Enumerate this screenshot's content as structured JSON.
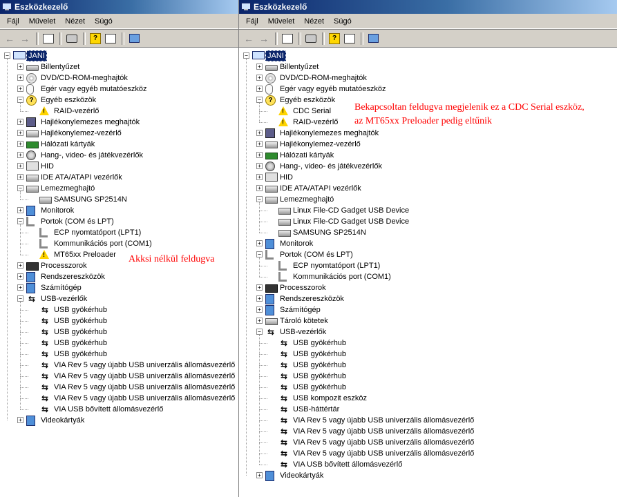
{
  "left": {
    "title": "Eszközkezelő",
    "menu": [
      "Fájl",
      "Művelet",
      "Nézet",
      "Súgó"
    ],
    "annotation": "Akksi nélkül feldugva",
    "tree": [
      {
        "level": 0,
        "text": "JANI",
        "icon": "computer-icon",
        "exp": "-",
        "selected": true
      },
      {
        "level": 1,
        "text": "Billentyűzet",
        "icon": "keyboard-icon",
        "exp": "+"
      },
      {
        "level": 1,
        "text": "DVD/CD-ROM-meghajtók",
        "icon": "disc-icon",
        "exp": "+"
      },
      {
        "level": 1,
        "text": "Egér vagy egyéb mutatóeszköz",
        "icon": "mouse-icon",
        "exp": "+"
      },
      {
        "level": 1,
        "text": "Egyéb eszközök",
        "icon": "question-icon",
        "exp": "-"
      },
      {
        "level": 2,
        "text": "RAID-vezérlő",
        "icon": "warning-icon"
      },
      {
        "level": 1,
        "text": "Hajlékonylemezes meghajtók",
        "icon": "floppy-icon",
        "exp": "+"
      },
      {
        "level": 1,
        "text": "Hajlékonylemez-vezérlő",
        "icon": "hdd-icon",
        "exp": "+"
      },
      {
        "level": 1,
        "text": "Hálózati kártyák",
        "icon": "network-icon",
        "exp": "+"
      },
      {
        "level": 1,
        "text": "Hang-, video- és játékvezérlők",
        "icon": "speaker-icon",
        "exp": "+"
      },
      {
        "level": 1,
        "text": "HID",
        "icon": "hid-icon",
        "exp": "+"
      },
      {
        "level": 1,
        "text": "IDE ATA/ATAPI vezérlők",
        "icon": "hdd-icon",
        "exp": "+"
      },
      {
        "level": 1,
        "text": "Lemezmeghajtó",
        "icon": "hdd-icon",
        "exp": "-"
      },
      {
        "level": 2,
        "text": "SAMSUNG SP2514N",
        "icon": "hdd-icon"
      },
      {
        "level": 1,
        "text": "Monitorok",
        "icon": "monitor-icon",
        "exp": "+"
      },
      {
        "level": 1,
        "text": "Portok (COM és LPT)",
        "icon": "port-icon",
        "exp": "-"
      },
      {
        "level": 2,
        "text": "ECP nyomtatóport (LPT1)",
        "icon": "port-icon"
      },
      {
        "level": 2,
        "text": "Kommunikációs port (COM1)",
        "icon": "port-icon"
      },
      {
        "level": 2,
        "text": "MT65xx Preloader",
        "icon": "warning-icon"
      },
      {
        "level": 1,
        "text": "Processzorok",
        "icon": "cpu-icon",
        "exp": "+"
      },
      {
        "level": 1,
        "text": "Rendszereszközök",
        "icon": "system-icon",
        "exp": "+"
      },
      {
        "level": 1,
        "text": "Számítógép",
        "icon": "system-icon",
        "exp": "+"
      },
      {
        "level": 1,
        "text": "USB-vezérlők",
        "icon": "usb-icon",
        "exp": "-"
      },
      {
        "level": 2,
        "text": "USB gyökérhub",
        "icon": "usb-icon"
      },
      {
        "level": 2,
        "text": "USB gyökérhub",
        "icon": "usb-icon"
      },
      {
        "level": 2,
        "text": "USB gyökérhub",
        "icon": "usb-icon"
      },
      {
        "level": 2,
        "text": "USB gyökérhub",
        "icon": "usb-icon"
      },
      {
        "level": 2,
        "text": "USB gyökérhub",
        "icon": "usb-icon"
      },
      {
        "level": 2,
        "text": "VIA Rev 5 vagy újabb USB univerzális állomásvezérlő",
        "icon": "usb-icon"
      },
      {
        "level": 2,
        "text": "VIA Rev 5 vagy újabb USB univerzális állomásvezérlő",
        "icon": "usb-icon"
      },
      {
        "level": 2,
        "text": "VIA Rev 5 vagy újabb USB univerzális állomásvezérlő",
        "icon": "usb-icon"
      },
      {
        "level": 2,
        "text": "VIA Rev 5 vagy újabb USB univerzális állomásvezérlő",
        "icon": "usb-icon"
      },
      {
        "level": 2,
        "text": "VIA USB bővített állomásvezérlő",
        "icon": "usb-icon"
      },
      {
        "level": 1,
        "text": "Videokártyák",
        "icon": "video-icon",
        "exp": "+"
      }
    ]
  },
  "right": {
    "title": "Eszközkezelő",
    "menu": [
      "Fájl",
      "Művelet",
      "Nézet",
      "Súgó"
    ],
    "annotation_line1": "Bekapcsoltan feldugva megjelenik ez a CDC Serial eszköz,",
    "annotation_line2": "az MT65xx Preloader pedig eltűnik",
    "tree": [
      {
        "level": 0,
        "text": "JANI",
        "icon": "computer-icon",
        "exp": "-",
        "selected": true
      },
      {
        "level": 1,
        "text": "Billentyűzet",
        "icon": "keyboard-icon",
        "exp": "+"
      },
      {
        "level": 1,
        "text": "DVD/CD-ROM-meghajtók",
        "icon": "disc-icon",
        "exp": "+"
      },
      {
        "level": 1,
        "text": "Egér vagy egyéb mutatóeszköz",
        "icon": "mouse-icon",
        "exp": "+"
      },
      {
        "level": 1,
        "text": "Egyéb eszközök",
        "icon": "question-icon",
        "exp": "-"
      },
      {
        "level": 2,
        "text": "CDC Serial",
        "icon": "warning-icon"
      },
      {
        "level": 2,
        "text": "RAID-vezérlő",
        "icon": "warning-icon"
      },
      {
        "level": 1,
        "text": "Hajlékonylemezes meghajtók",
        "icon": "floppy-icon",
        "exp": "+"
      },
      {
        "level": 1,
        "text": "Hajlékonylemez-vezérlő",
        "icon": "hdd-icon",
        "exp": "+"
      },
      {
        "level": 1,
        "text": "Hálózati kártyák",
        "icon": "network-icon",
        "exp": "+"
      },
      {
        "level": 1,
        "text": "Hang-, video- és játékvezérlők",
        "icon": "speaker-icon",
        "exp": "+"
      },
      {
        "level": 1,
        "text": "HID",
        "icon": "hid-icon",
        "exp": "+"
      },
      {
        "level": 1,
        "text": "IDE ATA/ATAPI vezérlők",
        "icon": "hdd-icon",
        "exp": "+"
      },
      {
        "level": 1,
        "text": "Lemezmeghajtó",
        "icon": "hdd-icon",
        "exp": "-"
      },
      {
        "level": 2,
        "text": "Linux File-CD Gadget USB Device",
        "icon": "hdd-icon"
      },
      {
        "level": 2,
        "text": "Linux File-CD Gadget USB Device",
        "icon": "hdd-icon"
      },
      {
        "level": 2,
        "text": "SAMSUNG SP2514N",
        "icon": "hdd-icon"
      },
      {
        "level": 1,
        "text": "Monitorok",
        "icon": "monitor-icon",
        "exp": "+"
      },
      {
        "level": 1,
        "text": "Portok (COM és LPT)",
        "icon": "port-icon",
        "exp": "-"
      },
      {
        "level": 2,
        "text": "ECP nyomtatóport (LPT1)",
        "icon": "port-icon"
      },
      {
        "level": 2,
        "text": "Kommunikációs port (COM1)",
        "icon": "port-icon"
      },
      {
        "level": 1,
        "text": "Processzorok",
        "icon": "cpu-icon",
        "exp": "+"
      },
      {
        "level": 1,
        "text": "Rendszereszközök",
        "icon": "system-icon",
        "exp": "+"
      },
      {
        "level": 1,
        "text": "Számítógép",
        "icon": "system-icon",
        "exp": "+"
      },
      {
        "level": 1,
        "text": "Tároló kötetek",
        "icon": "hdd-icon",
        "exp": "+"
      },
      {
        "level": 1,
        "text": "USB-vezérlők",
        "icon": "usb-icon",
        "exp": "-"
      },
      {
        "level": 2,
        "text": "USB gyökérhub",
        "icon": "usb-icon"
      },
      {
        "level": 2,
        "text": "USB gyökérhub",
        "icon": "usb-icon"
      },
      {
        "level": 2,
        "text": "USB gyökérhub",
        "icon": "usb-icon"
      },
      {
        "level": 2,
        "text": "USB gyökérhub",
        "icon": "usb-icon"
      },
      {
        "level": 2,
        "text": "USB gyökérhub",
        "icon": "usb-icon"
      },
      {
        "level": 2,
        "text": "USB kompozit eszköz",
        "icon": "usb-icon"
      },
      {
        "level": 2,
        "text": "USB-háttértár",
        "icon": "usb-icon"
      },
      {
        "level": 2,
        "text": "VIA Rev 5 vagy újabb USB univerzális állomásvezérlő",
        "icon": "usb-icon"
      },
      {
        "level": 2,
        "text": "VIA Rev 5 vagy újabb USB univerzális állomásvezérlő",
        "icon": "usb-icon"
      },
      {
        "level": 2,
        "text": "VIA Rev 5 vagy újabb USB univerzális állomásvezérlő",
        "icon": "usb-icon"
      },
      {
        "level": 2,
        "text": "VIA Rev 5 vagy újabb USB univerzális állomásvezérlő",
        "icon": "usb-icon"
      },
      {
        "level": 2,
        "text": "VIA USB bővített állomásvezérlő",
        "icon": "usb-icon"
      },
      {
        "level": 1,
        "text": "Videokártyák",
        "icon": "video-icon",
        "exp": "+"
      }
    ]
  },
  "colors": {
    "titlebar_start": "#0a246a",
    "chrome": "#d4d0c8",
    "annotation": "#ff0000",
    "selection": "#0a246a"
  }
}
